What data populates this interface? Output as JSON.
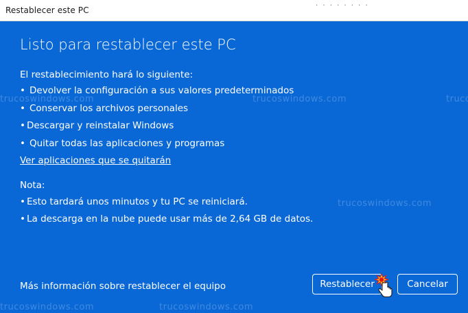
{
  "window": {
    "title": "Restablecer este PC",
    "title_dots": "· · · · · · · ·"
  },
  "main": {
    "heading": "Listo para restablecer este PC",
    "intro": "El restablecimiento hará lo siguiente:",
    "bullet_char": "•",
    "items": [
      "Devolver la configuración a sus valores predeterminados",
      "Conservar los archivos personales",
      "Descargar y reinstalar Windows",
      "Quitar todas las aplicaciones y programas"
    ],
    "apps_link": "Ver aplicaciones que se quitarán",
    "note_label": "Nota:",
    "notes": [
      "Esto tardará unos minutos y tu PC se reiniciará.",
      "La descarga en la nube puede usar más de 2,64 GB de datos."
    ],
    "more_info_link": "Más información sobre restablecer el equipo"
  },
  "buttons": {
    "reset": "Restablecer",
    "cancel": "Cancelar"
  },
  "watermark": "trucoswindows.com",
  "colors": {
    "background": "#0a68d6",
    "text": "#ffffff",
    "titlebar": "#ffffff"
  },
  "icons": {
    "cursor": "hand-pointer-cursor-icon",
    "click_burst": "click-burst-icon"
  }
}
